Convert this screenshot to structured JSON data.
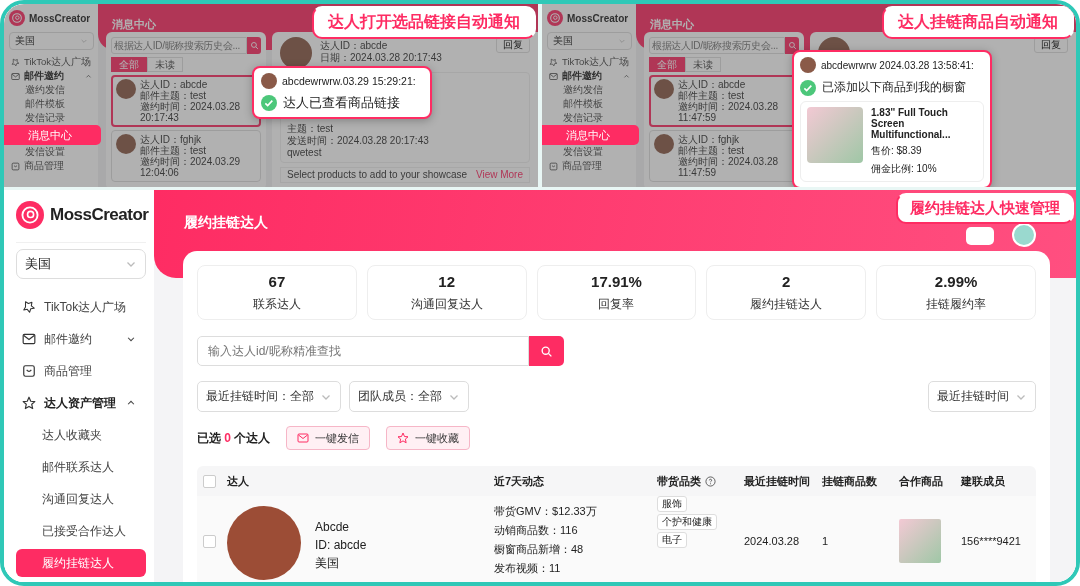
{
  "frames": [
    {
      "callout": "达人打开选品链接自动通知",
      "app": {
        "sidebar": {
          "logo": "MossCreator",
          "region": "美国",
          "nav": [
            {
              "label": "TikTok达人广场",
              "selected": false
            },
            {
              "label": "邮件邀约",
              "selected": false,
              "expanded": true,
              "children": [
                {
                  "label": "邀约发信",
                  "selected": false
                },
                {
                  "label": "邮件模板",
                  "selected": false
                },
                {
                  "label": "发信记录",
                  "selected": false
                },
                {
                  "label": "消息中心",
                  "selected": true
                },
                {
                  "label": "发信设置",
                  "selected": false
                }
              ]
            },
            {
              "label": "商品管理",
              "selected": false
            }
          ]
        },
        "page_title": "消息中心",
        "search": {
          "placeholder": "根据达人ID/昵称搜索历史会..."
        },
        "tabs": [
          {
            "label": "全部",
            "selected": true
          },
          {
            "label": "未读",
            "selected": false
          }
        ],
        "messages": [
          {
            "selected": true,
            "lines": [
              "达人ID：abcde",
              "邮件主题：test",
              "邀约时间：2024.03.28 20:17:43"
            ]
          },
          {
            "selected": false,
            "lines": [
              "达人ID：fghjk",
              "邮件主题：test",
              "邀约时间：2024.03.29 12:04:06"
            ]
          }
        ],
        "detail": {
          "info": [
            "达人ID：abcde",
            "日期：2024.03.28 20:17:43"
          ],
          "reply": "回复",
          "body": [
            "主题：test",
            "发送时间：2024.03.28 20:17:43",
            "qwetest"
          ],
          "showcase": "Select products to add to your showcase",
          "more": "View More"
        }
      },
      "popup": {
        "sender": "abcdewrwrw.03.29 15:29:21:",
        "message": "达人已查看商品链接"
      }
    },
    {
      "callout": "达人挂链商品自动通知",
      "app": {
        "sidebar": {
          "logo": "MossCreator",
          "region": "美国",
          "nav": [
            {
              "label": "TikTok达人广场",
              "selected": false
            },
            {
              "label": "邮件邀约",
              "selected": false,
              "expanded": true,
              "children": [
                {
                  "label": "邀约发信",
                  "selected": false
                },
                {
                  "label": "邮件模板",
                  "selected": false
                },
                {
                  "label": "发信记录",
                  "selected": false
                },
                {
                  "label": "消息中心",
                  "selected": true
                },
                {
                  "label": "发信设置",
                  "selected": false
                }
              ]
            },
            {
              "label": "商品管理",
              "selected": false
            }
          ]
        },
        "page_title": "消息中心",
        "search": {
          "placeholder": "根据达人ID/昵称搜索历史会..."
        },
        "tabs": [
          {
            "label": "全部",
            "selected": true
          },
          {
            "label": "未读",
            "selected": false
          }
        ],
        "messages": [
          {
            "selected": true,
            "lines": [
              "达人ID：abcde",
              "邮件主题：test",
              "邀约时间：2024.03.28 11:47:59"
            ]
          },
          {
            "selected": false,
            "lines": [
              "达人ID：fghjk",
              "邮件主题：test",
              "邀约时间：2024.03.28 11:47:59"
            ]
          }
        ],
        "detail": {
          "reply": "回复"
        }
      },
      "popup": {
        "sender": "abcdewrwrw 2024.03.28 13:58:41:",
        "message": "已添加以下商品到我的橱窗",
        "product": {
          "name": "1.83'' Full Touch Screen Multifunctional...",
          "price": "售价: $8.39",
          "commission": "佣金比例: 10%"
        }
      }
    }
  ],
  "main": {
    "callout": "履约挂链达人快速管理",
    "sidebar": {
      "logo": "MossCreator",
      "region": "美国",
      "nav": [
        {
          "label": "TikTok达人广场",
          "selected": false
        },
        {
          "label": "邮件邀约",
          "selected": false,
          "expanded": false
        },
        {
          "label": "商品管理",
          "selected": false
        },
        {
          "label": "达人资产管理",
          "selected": false,
          "expanded": true,
          "children": [
            {
              "label": "达人收藏夹",
              "selected": false
            },
            {
              "label": "邮件联系达人",
              "selected": false
            },
            {
              "label": "沟通回复达人",
              "selected": false
            },
            {
              "label": "已接受合作达人",
              "selected": false
            },
            {
              "label": "履约挂链达人",
              "selected": true
            }
          ]
        }
      ]
    },
    "page_title": "履约挂链达人",
    "stats": [
      {
        "value": "67",
        "label": "联系达人"
      },
      {
        "value": "12",
        "label": "沟通回复达人"
      },
      {
        "value": "17.91%",
        "label": "回复率"
      },
      {
        "value": "2",
        "label": "履约挂链达人"
      },
      {
        "value": "2.99%",
        "label": "挂链履约率"
      }
    ],
    "search": {
      "placeholder": "输入达人id/昵称精准查找"
    },
    "filters": [
      "最近挂链时间：全部",
      "团队成员：全部"
    ],
    "sort": "最近挂链时间",
    "selection": {
      "prefix": "已选",
      "count": "0",
      "suffix": "个达人"
    },
    "actions": [
      "一键发信",
      "一键收藏"
    ],
    "table": {
      "select_all_checked": false,
      "columns": [
        {
          "label": "达人",
          "help": false
        },
        {
          "label": "近7天动态",
          "help": false
        },
        {
          "label": "带货品类",
          "help": true
        },
        {
          "label": "最近挂链时间",
          "help": false
        },
        {
          "label": "挂链商品数",
          "help": false
        },
        {
          "label": "合作商品",
          "help": false
        },
        {
          "label": "建联成员",
          "help": false
        }
      ],
      "rows": [
        {
          "checked": false,
          "name": "Abcde",
          "id": "ID: abcde",
          "region": "美国",
          "activity": [
            "带货GMV：$12.33万",
            "动销商品数：116",
            "橱窗商品新增：48",
            "发布视频：11"
          ],
          "categories": [
            "服饰",
            "个护和健康",
            "电子"
          ],
          "last_linked": "2024.03.28",
          "linked_count": "1",
          "member": "156****9421"
        }
      ]
    }
  }
}
